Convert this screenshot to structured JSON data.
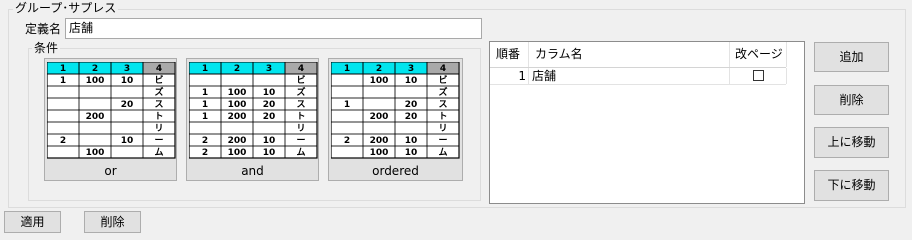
{
  "group": {
    "title": "グループ･サプレス",
    "def_label": "定義名",
    "def_value": "店舗",
    "conditions_label": "条件",
    "options": [
      {
        "caption": "or",
        "selected": true,
        "header": [
          "1",
          "2",
          "3",
          "4"
        ],
        "rows": [
          [
            "1",
            "100",
            "10",
            "ビ"
          ],
          [
            "",
            "",
            "",
            "ズ"
          ],
          [
            "",
            "",
            "20",
            "ス"
          ],
          [
            "",
            "200",
            "",
            "ト"
          ],
          [
            "",
            "",
            "",
            "リ"
          ],
          [
            "2",
            "",
            "10",
            "ー"
          ],
          [
            "",
            "100",
            "",
            "ム"
          ]
        ]
      },
      {
        "caption": "and",
        "selected": false,
        "header": [
          "1",
          "2",
          "3",
          "4"
        ],
        "rows": [
          [
            "",
            "",
            "",
            "ビ"
          ],
          [
            "1",
            "100",
            "10",
            "ズ"
          ],
          [
            "1",
            "100",
            "20",
            "ス"
          ],
          [
            "1",
            "200",
            "20",
            "ト"
          ],
          [
            "",
            "",
            "",
            "リ"
          ],
          [
            "2",
            "200",
            "10",
            "ー"
          ],
          [
            "2",
            "100",
            "10",
            "ム"
          ]
        ]
      },
      {
        "caption": "ordered",
        "selected": false,
        "header": [
          "1",
          "2",
          "3",
          "4"
        ],
        "rows": [
          [
            "",
            "100",
            "10",
            "ビ"
          ],
          [
            "",
            "",
            "",
            "ズ"
          ],
          [
            "1",
            "",
            "20",
            "ス"
          ],
          [
            "",
            "200",
            "20",
            "ト"
          ],
          [
            "",
            "",
            "",
            "リ"
          ],
          [
            "2",
            "200",
            "10",
            "ー"
          ],
          [
            "",
            "100",
            "10",
            "ム"
          ]
        ]
      }
    ]
  },
  "grid": {
    "columns": [
      "順番",
      "カラム名",
      "改ページ"
    ],
    "rows": [
      {
        "order": "1",
        "name": "店舗",
        "page_break": false
      }
    ]
  },
  "buttons": {
    "add": "追加",
    "delete": "削除",
    "move_up": "上に移動",
    "move_down": "下に移動",
    "apply": "適用",
    "delete_bottom": "削除"
  },
  "colors": {
    "header_cyan": "#00e5ee",
    "header_gray": "#a9a9a9",
    "selected_option": "#cce4f7"
  }
}
